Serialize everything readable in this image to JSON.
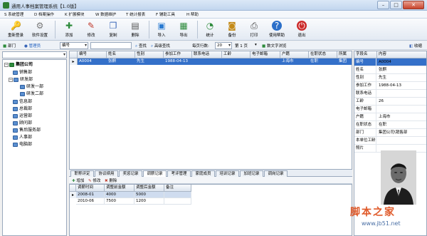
{
  "window": {
    "title": "通用人事档案管理系统【1.0版】",
    "min": "–",
    "max": "□",
    "close": "✕"
  },
  "menu": [
    {
      "label": "S 系统管理"
    },
    {
      "label": "D 档案操作"
    },
    {
      "label": "K 扩展模块"
    },
    {
      "label": "W 数据维护"
    },
    {
      "label": "T 统计报表"
    },
    {
      "label": "F 辅助工具"
    },
    {
      "label": "H 帮助"
    }
  ],
  "toolbar": [
    {
      "label": "重新登录",
      "icon": "key-icon",
      "glyph": "🔑"
    },
    {
      "label": "软件设置",
      "icon": "gear-icon",
      "glyph": "⚙"
    },
    {
      "label": "添加",
      "icon": "add-icon",
      "glyph": "✚"
    },
    {
      "label": "修改",
      "icon": "edit-icon",
      "glyph": "✎"
    },
    {
      "label": "复制",
      "icon": "copy-icon",
      "glyph": "❐"
    },
    {
      "label": "删除",
      "icon": "delete-icon",
      "glyph": "▤"
    },
    {
      "label": "导入",
      "icon": "import-icon",
      "glyph": "▣"
    },
    {
      "label": "导出",
      "icon": "export-icon",
      "glyph": "▦"
    },
    {
      "label": "统计",
      "icon": "chart-icon",
      "glyph": "◔"
    },
    {
      "label": "备份",
      "icon": "backup-icon",
      "glyph": "◙"
    },
    {
      "label": "打印",
      "icon": "print-icon",
      "glyph": "⎙"
    },
    {
      "label": "使用帮助",
      "icon": "help-icon",
      "glyph": "?"
    },
    {
      "label": "退出",
      "icon": "exit-icon",
      "glyph": "⏻"
    }
  ],
  "filter": {
    "org_label": "部门",
    "admin_label": "管理员",
    "field_value": "编号",
    "search_button": "查找",
    "advanced_search": "高级查找",
    "rows_label": "每页行数:",
    "rows_value": "20",
    "page_label": "第 1 页",
    "text_mode": "数文字浏览",
    "collapse": "收缩"
  },
  "tree": {
    "root": "集团公司",
    "nodes": [
      {
        "label": "销售部",
        "level": 1
      },
      {
        "label": "研发部",
        "level": 1
      },
      {
        "label": "研发一部",
        "level": 2
      },
      {
        "label": "研发二部",
        "level": 2
      },
      {
        "label": "信息部",
        "level": 1
      },
      {
        "label": "总裁部",
        "level": 1
      },
      {
        "label": "运营部",
        "level": 1
      },
      {
        "label": "顾问部",
        "level": 1
      },
      {
        "label": "售后服务部",
        "level": 1
      },
      {
        "label": "人事部",
        "level": 1
      },
      {
        "label": "电脑部",
        "level": 1
      }
    ]
  },
  "grid": {
    "columns": [
      "编号",
      "姓名",
      "性别",
      "参加工作",
      "联系电话",
      "工龄",
      "电子邮箱",
      "户籍",
      "在职状态",
      "所属"
    ],
    "rows": [
      [
        "A0004",
        "张麒",
        "先生",
        "1988-04-13",
        "",
        "",
        "",
        "上海市",
        "在职",
        "集团"
      ]
    ]
  },
  "tabs": [
    {
      "label": "职称评定"
    },
    {
      "label": "协议续用"
    },
    {
      "label": "奖惩记录"
    },
    {
      "label": "调薪记录",
      "active": true
    },
    {
      "label": "考评管理"
    },
    {
      "label": "家庭成员"
    },
    {
      "label": "培训记录"
    },
    {
      "label": "加班记录"
    },
    {
      "label": "调岗记录"
    }
  ],
  "subtoolbar": {
    "add": "增加",
    "edit": "修改",
    "delete": "删除"
  },
  "salary": {
    "columns": [
      "调薪时间",
      "调整前金额",
      "调整后金额",
      "备注"
    ],
    "rows": [
      [
        "2008-01",
        "4000",
        "5000",
        ""
      ],
      [
        "2010-06",
        "7500",
        "1200",
        ""
      ]
    ]
  },
  "props": {
    "header_key": "字段名",
    "header_value": "内容",
    "rows": [
      {
        "k": "编号",
        "v": "A0004"
      },
      {
        "k": "姓名",
        "v": "张麒"
      },
      {
        "k": "性别",
        "v": "先生"
      },
      {
        "k": "参加工作",
        "v": "1988-04-13"
      },
      {
        "k": "联系电话",
        "v": ""
      },
      {
        "k": "工龄",
        "v": "26"
      },
      {
        "k": "电子邮箱",
        "v": ""
      },
      {
        "k": "户籍",
        "v": "上海市"
      },
      {
        "k": "在职状态",
        "v": "在职"
      },
      {
        "k": "部门",
        "v": "集团公司\\销售部"
      },
      {
        "k": "本单位工龄",
        "v": ""
      },
      {
        "k": "照片",
        "v": ""
      }
    ]
  },
  "watermark": {
    "brand": "脚本之家",
    "url": "www.jb51.net"
  },
  "colors": {
    "selection": "#3470c9",
    "accent": "#1f5fbf"
  }
}
